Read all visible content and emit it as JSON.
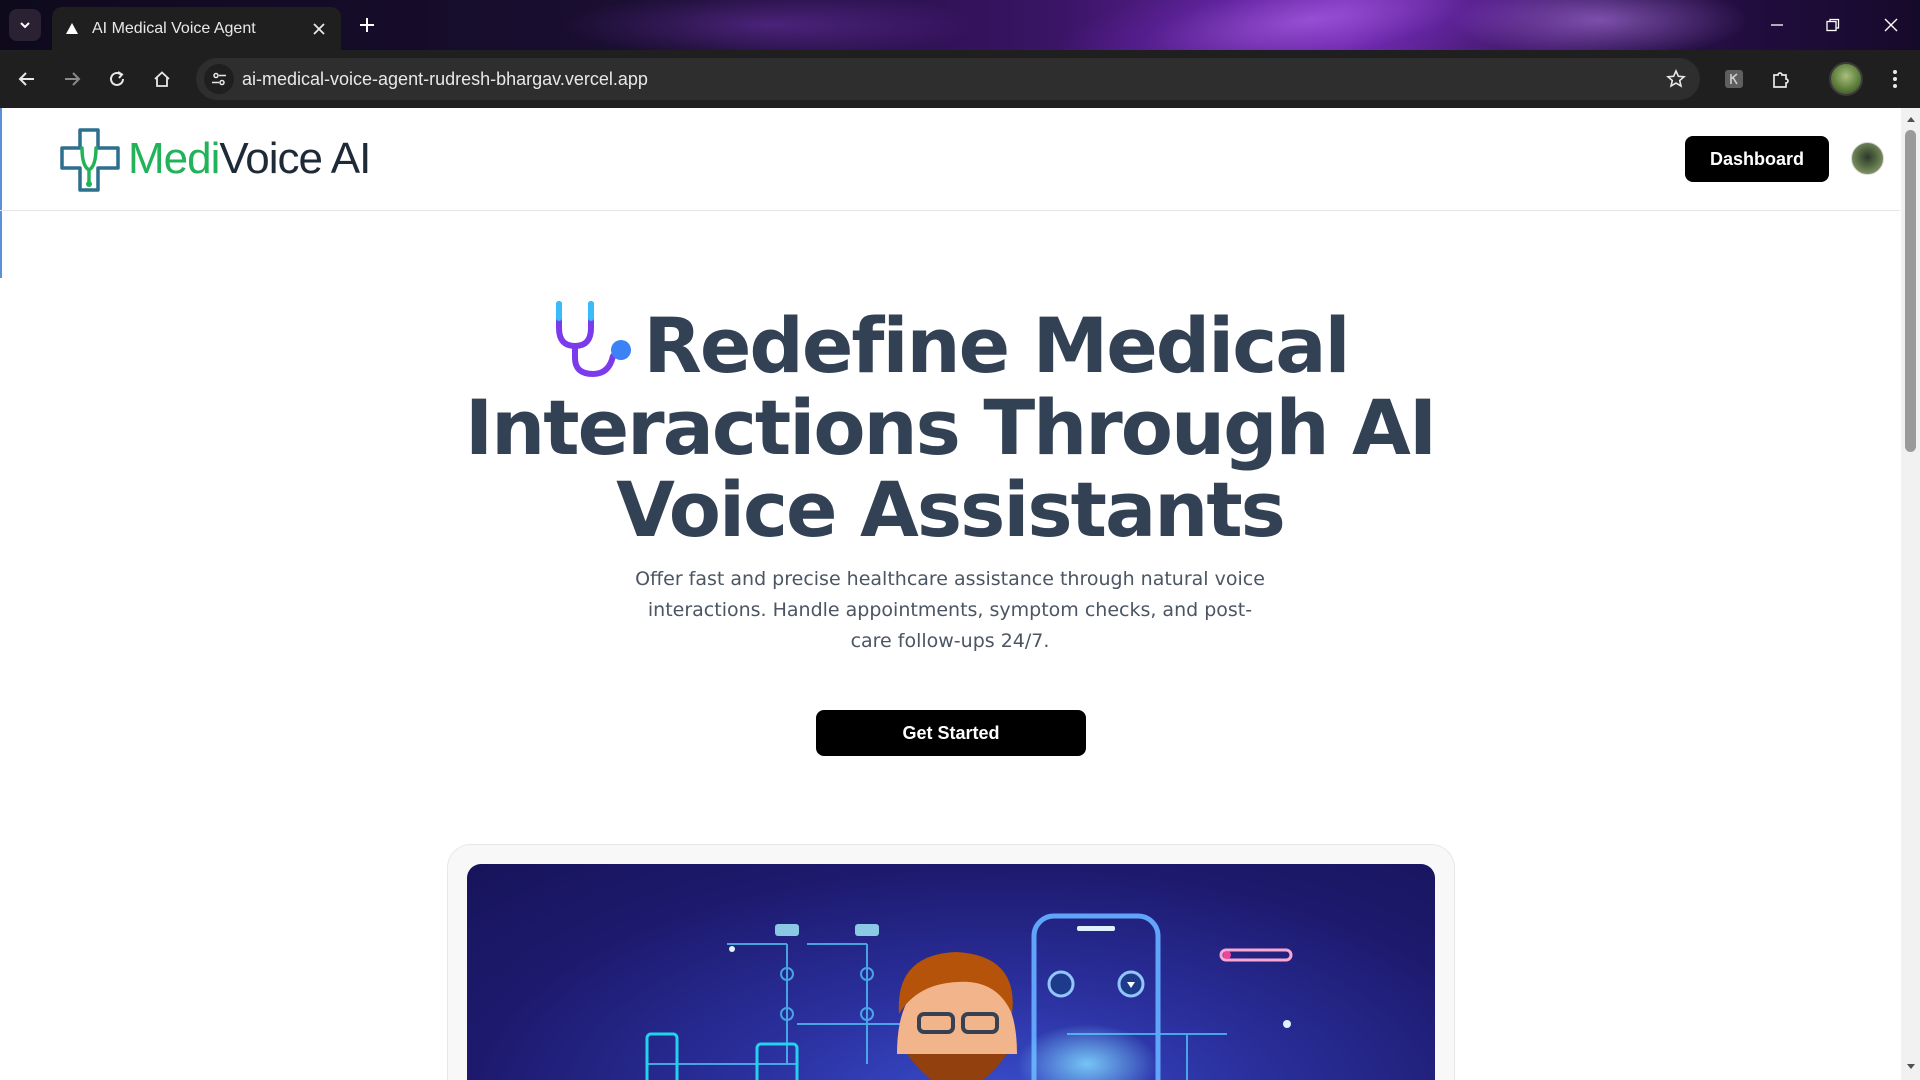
{
  "browser": {
    "tab_title": "AI Medical Voice Agent",
    "url": "ai-medical-voice-agent-rudresh-bhargav.vercel.app"
  },
  "header": {
    "logo_part1": "Medi",
    "logo_part2": "Voice AI",
    "dashboard_label": "Dashboard"
  },
  "hero": {
    "title_line1": "Redefine Medical",
    "title_line2": "Interactions Through AI",
    "title_line3": "Voice Assistants",
    "subtitle": "Offer fast and precise healthcare assistance through natural voice interactions. Handle appointments, symptom checks, and post-care follow-ups 24/7.",
    "cta_label": "Get Started"
  },
  "colors": {
    "brand_green": "#22b35a",
    "heading": "#334155",
    "button_bg": "#000000"
  }
}
